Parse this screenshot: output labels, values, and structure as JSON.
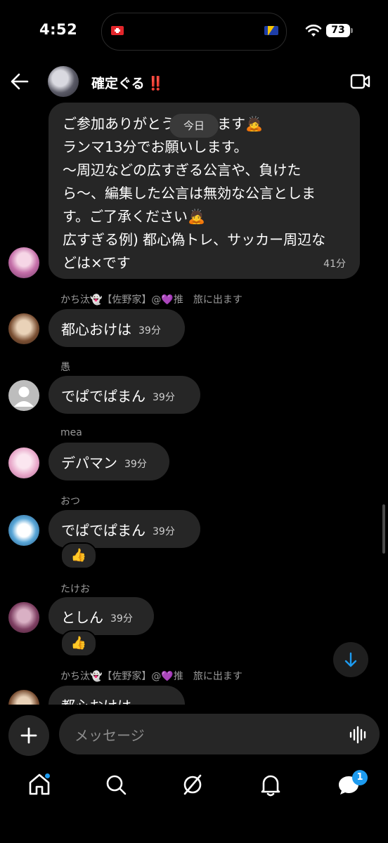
{
  "status": {
    "time": "4:52",
    "battery": "73"
  },
  "header": {
    "title": "確定ぐる",
    "title_mark": "‼️"
  },
  "date_pill": "今日",
  "first_message": {
    "lines": [
      "ご参加ありがとうございます🙇",
      "ランマ13分でお願いします。",
      "〜周辺などの広すぎる公言や、負けた",
      "ら〜、編集した公言は無効な公言としま",
      "す。ご了承ください🙇",
      "広すぎる例) 都心偽トレ、サッカー周辺な",
      "どは×です"
    ],
    "time": "41分"
  },
  "messages": [
    {
      "sender": "かち汰👻【佐野家】@💜推　旅に出ます",
      "text": "都心おけは",
      "time": "39分",
      "reaction": ""
    },
    {
      "sender": "愚",
      "text": "でぱでぱまん",
      "time": "39分",
      "reaction": ""
    },
    {
      "sender": "mea",
      "text": "デパマン",
      "time": "39分",
      "reaction": ""
    },
    {
      "sender": "おつ",
      "text": "でぱでぱまん",
      "time": "39分",
      "reaction": "👍"
    },
    {
      "sender": "たけお",
      "text": "としん",
      "time": "39分",
      "reaction": "👍"
    },
    {
      "sender": "かち汰👻【佐野家】@💜推　旅に出ます",
      "text": "都心おけは",
      "time": "",
      "reaction": ""
    }
  ],
  "composer": {
    "placeholder": "メッセージ"
  },
  "tabbar": {
    "messages_badge": "1"
  },
  "colors": {
    "accent": "#1d9bf0",
    "bubble": "#262626",
    "background": "#000000",
    "alert": "#e53030"
  }
}
